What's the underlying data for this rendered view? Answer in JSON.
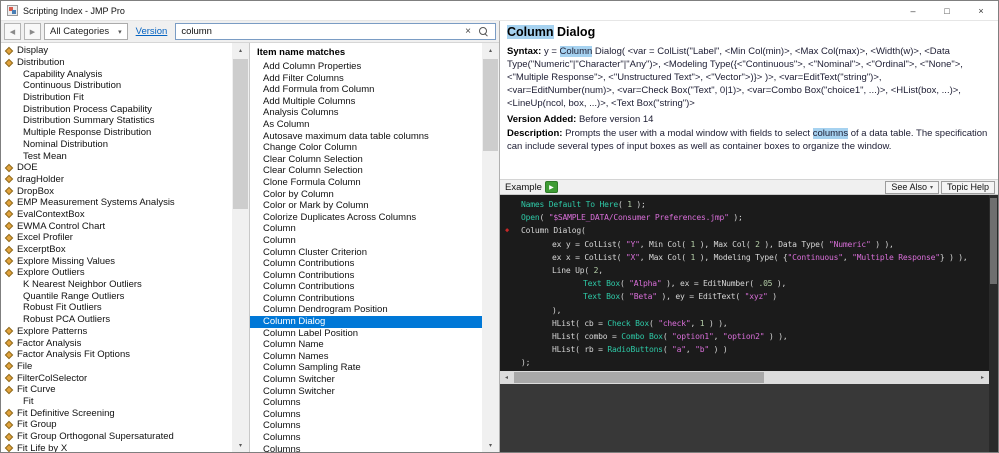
{
  "window": {
    "title": "Scripting Index - JMP Pro"
  },
  "icons": {
    "back": "◀",
    "forward": "▶",
    "dropdown_arrow": "▾",
    "clear": "×",
    "minimize": "–",
    "maximize": "□",
    "close": "×",
    "play": "▶",
    "see_also_arrow": "▾",
    "breakpoint": "◆",
    "scroll_up": "▴",
    "scroll_down": "▾",
    "scroll_left": "◂",
    "scroll_right": "▸"
  },
  "colors": {
    "selection": "#0078d7",
    "search_highlight": "#a6d2f0",
    "link": "#0563c1",
    "code_background": "#1b1b1b",
    "code_function": "#2ec8a6",
    "code_string": "#d86ed8",
    "code_number": "#b5cea8",
    "code_plain": "#d6d6d6",
    "marker": "#c62828",
    "play_button": "#3f9c35",
    "category_icon": "#e2a33c"
  },
  "toolbar": {
    "categories_dropdown": "All Categories",
    "version_link": "Version",
    "search_value": "column"
  },
  "left_panel": {
    "items": [
      {
        "label": "Display",
        "level": 0
      },
      {
        "label": "Distribution",
        "level": 0
      },
      {
        "label": "Capability Analysis",
        "level": 1
      },
      {
        "label": "Continuous Distribution",
        "level": 1
      },
      {
        "label": "Distribution Fit",
        "level": 1
      },
      {
        "label": "Distribution Process Capability",
        "level": 1
      },
      {
        "label": "Distribution Summary Statistics",
        "level": 1
      },
      {
        "label": "Multiple Response Distribution",
        "level": 1
      },
      {
        "label": "Nominal Distribution",
        "level": 1
      },
      {
        "label": "Test Mean",
        "level": 1
      },
      {
        "label": "DOE",
        "level": 0
      },
      {
        "label": "dragHolder",
        "level": 0
      },
      {
        "label": "DropBox",
        "level": 0
      },
      {
        "label": "EMP Measurement Systems Analysis",
        "level": 0
      },
      {
        "label": "EvalContextBox",
        "level": 0
      },
      {
        "label": "EWMA Control Chart",
        "level": 0
      },
      {
        "label": "Excel Profiler",
        "level": 0
      },
      {
        "label": "ExcerptBox",
        "level": 0
      },
      {
        "label": "Explore Missing Values",
        "level": 0
      },
      {
        "label": "Explore Outliers",
        "level": 0
      },
      {
        "label": "K Nearest Neighbor Outliers",
        "level": 1
      },
      {
        "label": "Quantile Range Outliers",
        "level": 1
      },
      {
        "label": "Robust Fit Outliers",
        "level": 1
      },
      {
        "label": "Robust PCA Outliers",
        "level": 1
      },
      {
        "label": "Explore Patterns",
        "level": 0
      },
      {
        "label": "Factor Analysis",
        "level": 0
      },
      {
        "label": "Factor Analysis Fit Options",
        "level": 0
      },
      {
        "label": "File",
        "level": 0
      },
      {
        "label": "FilterColSelector",
        "level": 0
      },
      {
        "label": "Fit Curve",
        "level": 0
      },
      {
        "label": "Fit",
        "level": 1
      },
      {
        "label": "Fit Definitive Screening",
        "level": 0
      },
      {
        "label": "Fit Group",
        "level": 0
      },
      {
        "label": "Fit Group Orthogonal Supersaturated",
        "level": 0
      },
      {
        "label": "Fit Life by X",
        "level": 0
      }
    ]
  },
  "middle_panel": {
    "header": "Item name matches",
    "selected_index": 22,
    "items": [
      "Add Column Properties",
      "Add Filter Columns",
      "Add Formula from Column",
      "Add Multiple Columns",
      "Analysis Columns",
      "As Column",
      "Autosave maximum data table columns",
      "Change Color Column",
      "Clear Column Selection",
      "Clear Column Selection",
      "Clone Formula Column",
      "Color by Column",
      "Color or Mark by Column",
      "Colorize Duplicates Across Columns",
      "Column",
      "Column",
      "Column Cluster Criterion",
      "Column Contributions",
      "Column Contributions",
      "Column Contributions",
      "Column Contributions",
      "Column Dendrogram Position",
      "Column Dialog",
      "Column Label Position",
      "Column Name",
      "Column Names",
      "Column Sampling Rate",
      "Column Switcher",
      "Column Switcher",
      "Columns",
      "Columns",
      "Columns",
      "Columns",
      "Columns"
    ]
  },
  "doc_panel": {
    "title_segments": [
      {
        "t": "Column",
        "hl": true
      },
      {
        "t": " Dialog"
      }
    ],
    "syntax_label": "Syntax: ",
    "syntax_segments": [
      {
        "t": "y = "
      },
      {
        "t": "Column",
        "hl": true
      },
      {
        "t": " Dialog( <var = ColList(\"Label\", <Min Col(min)>, <Max Col(max)>, <Width(w)>, <Data Type(\"Numeric\"|\"Character\"|\"Any\")>, <Modeling Type({<\"Continuous\">, <\"Nominal\">, <\"Ordinal\">, <\"None\">, <\"Multiple Response\">, <\"Unstructured Text\">, <\"Vector\">)}> )>, <var=EditText(\"string\")>, <var=EditNumber(num)>, <var=Check Box(\"Text\", 0|1)>, <var=Combo Box(\"choice1\", ...)>, <HList(box, ...)>, <LineUp(ncol, box, ...)>, <Text Box(\"string\")>"
      }
    ],
    "version_label": "Version Added: ",
    "version_value": "Before version 14",
    "description_label": "Description: ",
    "description_segments": [
      {
        "t": "Prompts the user with a modal window with fields to select "
      },
      {
        "t": "columns",
        "hl": true
      },
      {
        "t": " of a data table. The specification can include several types of input boxes as well as container boxes to organize the window."
      }
    ],
    "example_label": "Example",
    "see_also_label": "See Also",
    "topic_help_label": "Topic Help"
  },
  "example_code": {
    "lines": [
      {
        "indent": 0,
        "marker": false,
        "tokens": [
          [
            "fn",
            "Names Default To Here"
          ],
          [
            "pl",
            "( "
          ],
          [
            "num",
            "1"
          ],
          [
            "pl",
            " );"
          ]
        ]
      },
      {
        "indent": 0,
        "marker": false,
        "tokens": [
          [
            "fn",
            "Open"
          ],
          [
            "pl",
            "( "
          ],
          [
            "str",
            "\"$SAMPLE_DATA/Consumer Preferences.jmp\""
          ],
          [
            "pl",
            " );"
          ]
        ]
      },
      {
        "indent": 0,
        "marker": true,
        "tokens": [
          [
            "pl",
            "Column Dialog("
          ]
        ]
      },
      {
        "indent": 1,
        "marker": false,
        "tokens": [
          [
            "pl",
            "ex y = ColList( "
          ],
          [
            "str",
            "\"Y\""
          ],
          [
            "pl",
            ", Min Col( "
          ],
          [
            "num",
            "1"
          ],
          [
            "pl",
            " ), Max Col( "
          ],
          [
            "num",
            "2"
          ],
          [
            "pl",
            " ), Data Type( "
          ],
          [
            "str",
            "\"Numeric\""
          ],
          [
            "pl",
            " ) ),"
          ]
        ]
      },
      {
        "indent": 1,
        "marker": false,
        "tokens": [
          [
            "pl",
            "ex x = ColList( "
          ],
          [
            "str",
            "\"X\""
          ],
          [
            "pl",
            ", Max Col( "
          ],
          [
            "num",
            "1"
          ],
          [
            "pl",
            " ), Modeling Type( {"
          ],
          [
            "str",
            "\"Continuous\""
          ],
          [
            "pl",
            ", "
          ],
          [
            "str",
            "\"Multiple Response\""
          ],
          [
            "pl",
            "} ) ),"
          ]
        ]
      },
      {
        "indent": 1,
        "marker": false,
        "tokens": [
          [
            "pl",
            "Line Up( "
          ],
          [
            "num",
            "2"
          ],
          [
            "pl",
            ","
          ]
        ]
      },
      {
        "indent": 2,
        "marker": false,
        "tokens": [
          [
            "fn",
            "Text Box"
          ],
          [
            "pl",
            "( "
          ],
          [
            "str",
            "\"Alpha\""
          ],
          [
            "pl",
            " ), ex = EditNumber( "
          ],
          [
            "num",
            ".05"
          ],
          [
            "pl",
            " ),"
          ]
        ]
      },
      {
        "indent": 2,
        "marker": false,
        "tokens": [
          [
            "fn",
            "Text Box"
          ],
          [
            "pl",
            "( "
          ],
          [
            "str",
            "\"Beta\""
          ],
          [
            "pl",
            " ), ey = EditText( "
          ],
          [
            "str",
            "\"xyz\""
          ],
          [
            "pl",
            " )"
          ]
        ]
      },
      {
        "indent": 1,
        "marker": false,
        "tokens": [
          [
            "pl",
            "),"
          ]
        ]
      },
      {
        "indent": 1,
        "marker": false,
        "tokens": [
          [
            "pl",
            "HList( cb = "
          ],
          [
            "fn",
            "Check Box"
          ],
          [
            "pl",
            "( "
          ],
          [
            "str",
            "\"check\""
          ],
          [
            "pl",
            ", "
          ],
          [
            "num",
            "1"
          ],
          [
            "pl",
            " ) ),"
          ]
        ]
      },
      {
        "indent": 1,
        "marker": false,
        "tokens": [
          [
            "pl",
            "HList( combo = "
          ],
          [
            "fn",
            "Combo Box"
          ],
          [
            "pl",
            "( "
          ],
          [
            "str",
            "\"option1\""
          ],
          [
            "pl",
            ", "
          ],
          [
            "str",
            "\"option2\""
          ],
          [
            "pl",
            " ) ),"
          ]
        ]
      },
      {
        "indent": 1,
        "marker": false,
        "tokens": [
          [
            "pl",
            "HList( rb = "
          ],
          [
            "fn",
            "RadioButtons"
          ],
          [
            "pl",
            "( "
          ],
          [
            "str",
            "\"a\""
          ],
          [
            "pl",
            ", "
          ],
          [
            "str",
            "\"b\""
          ],
          [
            "pl",
            " ) )"
          ]
        ]
      },
      {
        "indent": 0,
        "marker": false,
        "tokens": [
          [
            "pl",
            ");"
          ]
        ]
      }
    ]
  }
}
